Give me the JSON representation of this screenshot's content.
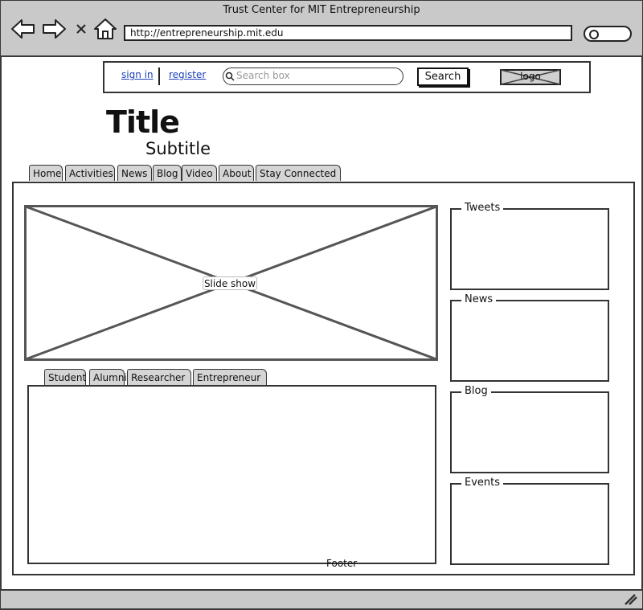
{
  "browser": {
    "window_title": "Trust Center for MIT Entrepreneurship",
    "url": "http://entrepreneurship.mit.edu"
  },
  "header": {
    "sign_in": "sign in",
    "register": "register",
    "search_placeholder": "Search box",
    "search_button": "Search",
    "logo": "logo"
  },
  "page": {
    "title": "Title",
    "subtitle": "Subtitle"
  },
  "main_tabs": [
    "Home",
    "Activities",
    "News",
    "Blog",
    "Video",
    "About",
    "Stay Connected"
  ],
  "slideshow": {
    "label": "Slide show"
  },
  "user_tabs": [
    "Student",
    "Alumni",
    "Researcher",
    "Entrepreneur"
  ],
  "footer": "Footer",
  "sidebar": {
    "tweets": "Tweets",
    "news": "News",
    "blog": "Blog",
    "events": "Events"
  }
}
